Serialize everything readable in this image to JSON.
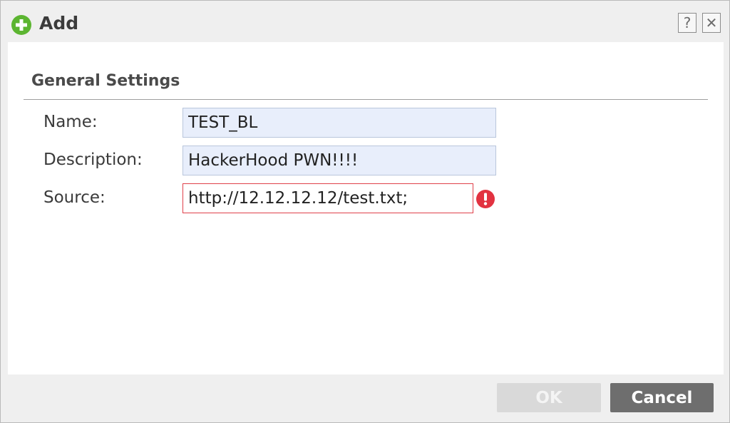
{
  "dialog": {
    "title": "Add",
    "help_label": "?",
    "close_label": "✕",
    "icons": {
      "title": "add-circle-icon",
      "error": "error-exclamation-icon"
    },
    "colors": {
      "add_icon": "#5cb531",
      "error": "#e23240",
      "input_bg": "#e8eefb",
      "error_border": "#e0404a"
    }
  },
  "general_settings": {
    "title": "General Settings",
    "fields": {
      "name": {
        "label": "Name:",
        "value": "TEST_BL"
      },
      "description": {
        "label": "Description:",
        "value": "HackerHood PWN!!!!"
      },
      "source": {
        "label": "Source:",
        "value": "http://12.12.12.12/test.txt;",
        "has_error": true
      }
    }
  },
  "footer": {
    "ok_label": "OK",
    "cancel_label": "Cancel"
  }
}
